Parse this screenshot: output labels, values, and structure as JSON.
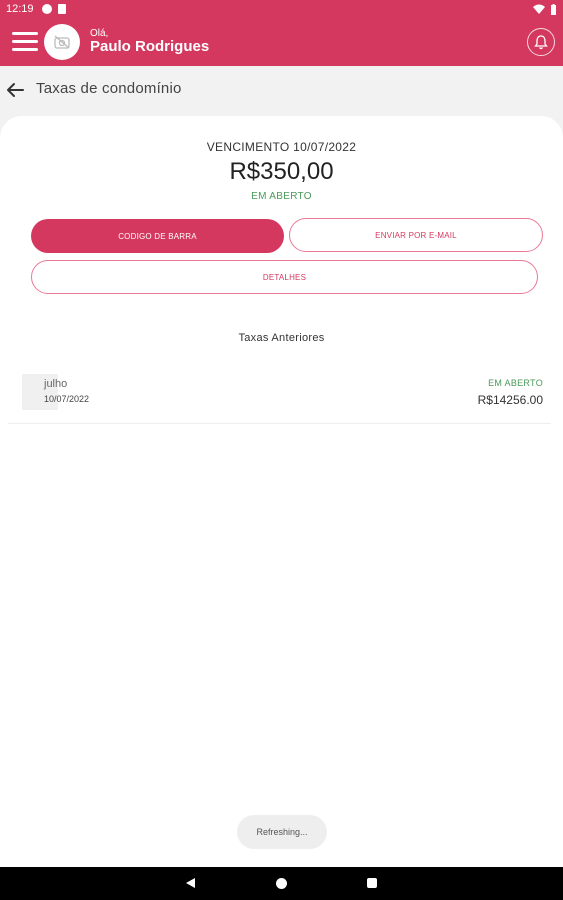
{
  "status_bar": {
    "time": "12:19"
  },
  "header": {
    "greeting": "Olá,",
    "user_name": "Paulo Rodrigues"
  },
  "page": {
    "title": "Taxas de condomínio"
  },
  "current_fee": {
    "due_label": "VENCIMENTO 10/07/2022",
    "amount": "R$350,00",
    "status": "EM ABERTO",
    "barcode_button": "CODIGO DE BARRA",
    "email_button": "ENVIAR POR E-MAIL",
    "details_button": "DETALHES"
  },
  "previous": {
    "title": "Taxas Anteriores",
    "items": [
      {
        "month": "julho",
        "date": "10/07/2022",
        "status": "EM ABERTO",
        "amount": "R$14256.00"
      }
    ]
  },
  "toast": "Refreshing...",
  "colors": {
    "brand": "#d5385f",
    "status_open": "#4a9a5a",
    "background": "#f2f2f2"
  },
  "icons": [
    "menu-icon",
    "camera-off-icon",
    "bell-icon",
    "arrow-left-icon",
    "wifi-icon",
    "battery-icon"
  ]
}
